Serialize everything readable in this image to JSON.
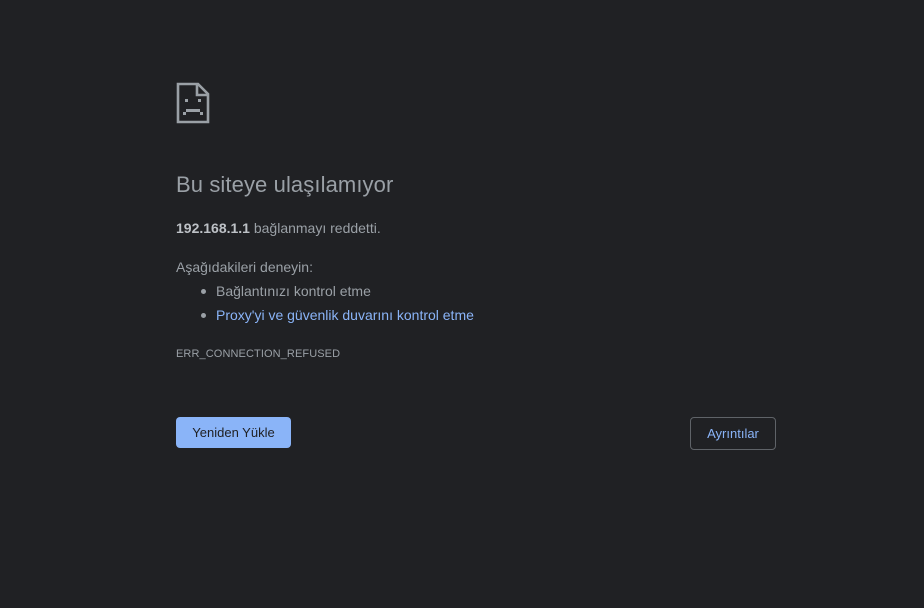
{
  "error_page": {
    "icon": "sad-page-icon",
    "title": "Bu siteye ulaşılamıyor",
    "host": "192.168.1.1",
    "refused_message": " bağlanmayı reddetti.",
    "try_label": "Aşağıdakileri deneyin:",
    "suggestions": [
      "Bağlantınızı kontrol etme",
      "Proxy'yi ve güvenlik duvarını kontrol etme"
    ],
    "error_code": "ERR_CONNECTION_REFUSED",
    "reload_label": "Yeniden Yükle",
    "details_label": "Ayrıntılar"
  },
  "colors": {
    "background": "#202124",
    "text": "#9aa0a6",
    "link": "#8ab4f8",
    "button_primary": "#8ab4f8"
  }
}
